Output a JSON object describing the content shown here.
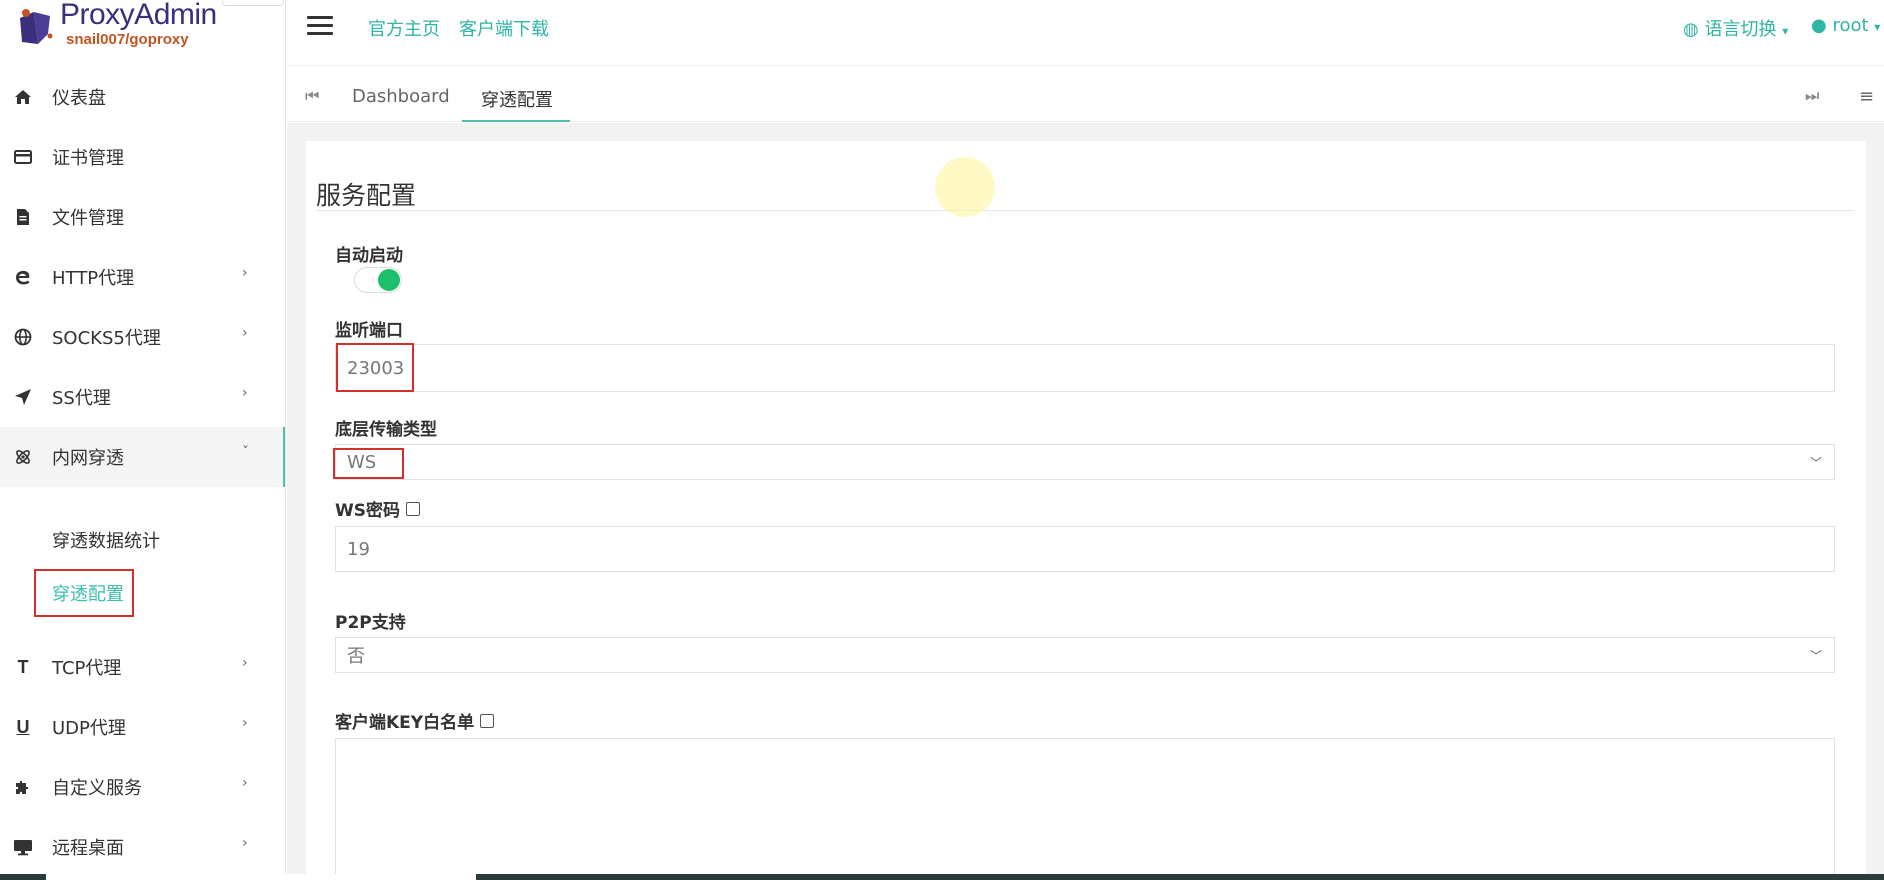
{
  "brand": {
    "title": "ProxyAdmin",
    "subtitle": "snail007/goproxy"
  },
  "sidebar": {
    "items": [
      {
        "label": "仪表盘",
        "icon": "home-icon",
        "has_arrow": false
      },
      {
        "label": "证书管理",
        "icon": "credit-card-icon",
        "has_arrow": false
      },
      {
        "label": "文件管理",
        "icon": "file-icon",
        "has_arrow": false
      },
      {
        "label": "HTTP代理",
        "icon": "internet-explorer-icon",
        "has_arrow": true
      },
      {
        "label": "SOCKS5代理",
        "icon": "globe-icon",
        "has_arrow": true
      },
      {
        "label": "SS代理",
        "icon": "paper-plane-icon",
        "has_arrow": true
      },
      {
        "label": "内网穿透",
        "icon": "atom-icon",
        "has_arrow": true,
        "open": true
      },
      {
        "label": "TCP代理",
        "icon": "text-t-icon",
        "has_arrow": true
      },
      {
        "label": "UDP代理",
        "icon": "underline-u-icon",
        "has_arrow": true
      },
      {
        "label": "自定义服务",
        "icon": "puzzle-icon",
        "has_arrow": true
      },
      {
        "label": "远程桌面",
        "icon": "monitor-icon",
        "has_arrow": true
      }
    ],
    "submenu": [
      {
        "label": "穿透数据统计",
        "active": false
      },
      {
        "label": "穿透配置",
        "active": true
      }
    ]
  },
  "topbar": {
    "links": [
      "官方主页",
      "客户端下载"
    ],
    "language": "语言切换",
    "user": "root"
  },
  "tabs": {
    "items": [
      "Dashboard",
      "穿透配置"
    ],
    "active_index": 1
  },
  "form": {
    "title": "服务配置",
    "auto_start": {
      "label": "自动启动",
      "enabled": true
    },
    "listen_port": {
      "label": "监听端口",
      "value": "23003"
    },
    "transport_type": {
      "label": "底层传输类型",
      "value": "WS"
    },
    "ws_password": {
      "label": "WS密码",
      "value": "19"
    },
    "p2p": {
      "label": "P2P支持",
      "value": "否"
    },
    "client_key_whitelist": {
      "label": "客户端KEY白名单",
      "value": ""
    }
  },
  "colors": {
    "accent": "#3bbfae",
    "toggle_on": "#1cbf6a",
    "highlight_box": "#d2302b"
  }
}
